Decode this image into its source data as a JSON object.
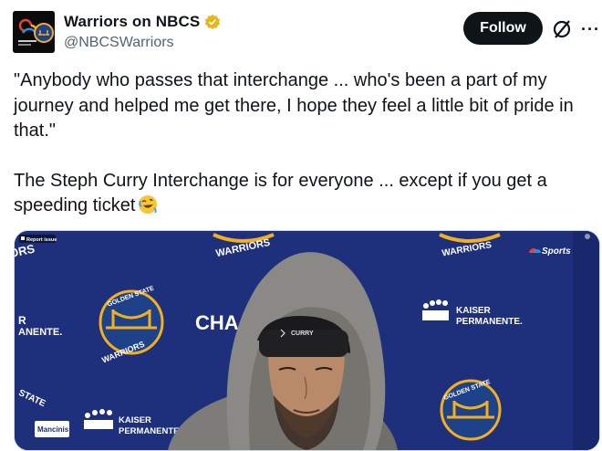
{
  "account": {
    "display_name": "Warriors on NBCS",
    "handle": "@NBCSWarriors",
    "follow_label": "Follow",
    "more_label": "···"
  },
  "tweet": {
    "paragraph_1": "\"Anybody who passes that interchange ... who's been a part of my journey and helped me get there, I hope they feel a little bit of pride in that.\"",
    "paragraph_2": "The Steph Curry Interchange is for everyone ... except if you get a speeding ticket"
  },
  "media": {
    "report_label": "Report issue",
    "backdrop_warriors": "WARRIORS",
    "backdrop_golden_state": "GOLDEN STATE",
    "backdrop_kaiser": "KAISER",
    "backdrop_permanente": "PERMANENTE.",
    "backdrop_chase": "CHA",
    "backdrop_ors": "ORS",
    "backdrop_r": "R",
    "backdrop_anente": "ANENTE.",
    "backdrop_state": "STATE",
    "hat_text": "CURRY",
    "sponsor_logo": "Mancinis",
    "broadcaster_logo": "Sports"
  },
  "colors": {
    "follow_bg": "#0f1419",
    "verified_gold": "#e2b719",
    "backdrop_blue": "#1d2d75",
    "warriors_gold": "#f2b01e"
  }
}
